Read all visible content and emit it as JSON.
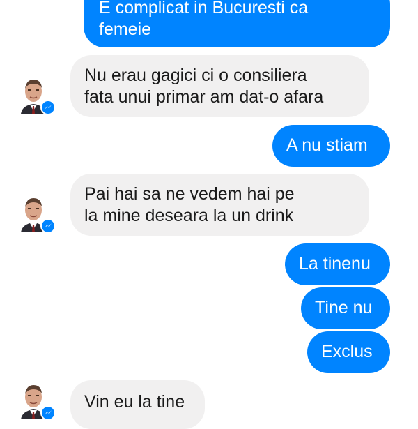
{
  "conversation": {
    "messages": [
      {
        "sender": "me",
        "text": "E complicat in Bucuresti ca\nfemeie"
      },
      {
        "sender": "contact",
        "text": "Nu erau gagici ci o consiliera\nfata unui primar am dat-o afara"
      },
      {
        "sender": "me",
        "text": "A nu stiam"
      },
      {
        "sender": "contact",
        "text": "Pai hai sa ne vedem hai pe\nla mine deseara la un drink"
      },
      {
        "sender": "me",
        "text": "La tinenu"
      },
      {
        "sender": "me",
        "text": "Tine nu"
      },
      {
        "sender": "me",
        "text": "Exclus"
      },
      {
        "sender": "contact",
        "text": "Vin eu la tine"
      }
    ]
  },
  "avatar": {
    "icon": "contact-avatar-icon",
    "badge_icon": "messenger-badge-icon"
  },
  "colors": {
    "outgoing_bubble": "#0084ff",
    "incoming_bubble": "#f1f0f0",
    "outgoing_text": "#ffffff",
    "incoming_text": "#1a1a1a"
  }
}
